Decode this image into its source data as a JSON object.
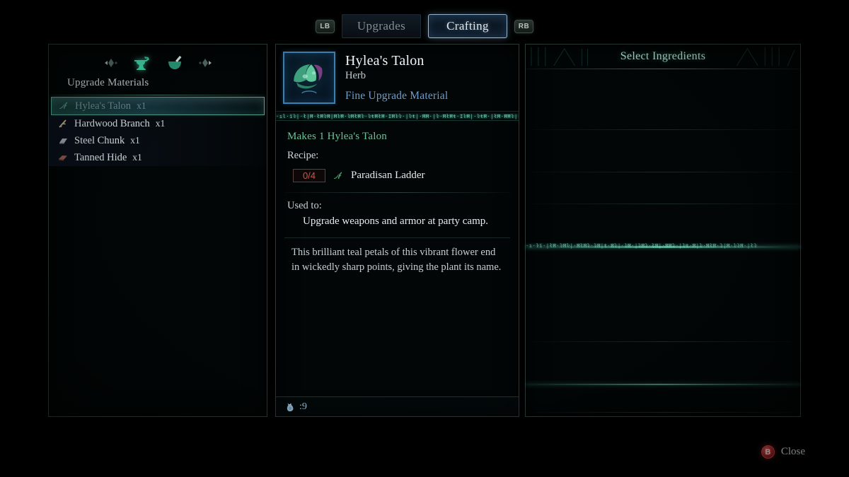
{
  "topbar": {
    "left_bumper": "LB",
    "right_bumper": "RB",
    "tabs": [
      {
        "label": "Upgrades",
        "active": false
      },
      {
        "label": "Crafting",
        "active": true
      }
    ]
  },
  "left_panel": {
    "prev_arrow_icon": "left-arrow-diamond-icon",
    "next_arrow_icon": "right-arrow-diamond-icon",
    "categories": [
      {
        "icon": "anvil-icon",
        "selected": true
      },
      {
        "icon": "mortar-pestle-icon",
        "selected": false
      }
    ],
    "category_title": "Upgrade Materials",
    "materials": [
      {
        "icon": "herb-icon",
        "name": "Hylea's Talon",
        "qty": "x1",
        "selected": true
      },
      {
        "icon": "branch-icon",
        "name": "Hardwood Branch",
        "qty": "x1",
        "selected": false
      },
      {
        "icon": "ingot-icon",
        "name": "Steel Chunk",
        "qty": "x1",
        "selected": false
      },
      {
        "icon": "hide-icon",
        "name": "Tanned Hide",
        "qty": "x1",
        "selected": false
      }
    ]
  },
  "center_panel": {
    "item_icon": "hyleas-talon-flower-icon",
    "item_name": "Hylea's Talon",
    "item_type": "Herb",
    "item_grade": "Fine Upgrade Material",
    "makes_line": "Makes 1 Hylea's Talon",
    "recipe_label": "Recipe:",
    "ingredients": [
      {
        "count": "0/4",
        "icon": "herb-icon",
        "name": "Paradisan Ladder"
      }
    ],
    "used_to_label": "Used to:",
    "used_to_value": "Upgrade weapons and armor at party camp.",
    "description": "This brilliant teal petals of this vibrant flower end in wickedly sharp points, giving the plant its name.",
    "currency_icon": "coin-pouch-icon",
    "currency_value": ":9"
  },
  "right_panel": {
    "title": "Select Ingredients"
  },
  "footer": {
    "close_button_glyph": "B",
    "close_label": "Close"
  },
  "colors": {
    "accent_teal": "#6cc49a",
    "accent_blue": "#6f9ece",
    "active_tab_border": "#9fc4de",
    "count_red": "#c05a4e",
    "selection_border": "#4f9f8c",
    "close_red": "#a81f24"
  },
  "runes": {
    "center": "·ıl·ĭŀ|·ł|Ħ·łĦŀĦ|ĦŀĦ·ŀĦłĦŀ·ŀŧĦłĦ·ĬĦŀŀ·|ŀŧ|·ĦĦ·|ŀ·ĦłĦŧ·ĬŀĦ|·ŀŧĦ·|łĦ·ĦĦŀ|·ŧĦ|·ĦŀĦ·ł|ŀ",
    "right": "·ı·ŀĭ·|łĦ·ŀĦŀ|·ĦłĦŀ·ŀĦ|ŧ·Ħŀ|·ŀĦ·|ŀĦŀ·łĦ|·ĦĦŀ·|ŀŧ·Ħ|ŀ·ĦłĦ·ŀ|Ħ·ŀŀĦ·|łŀ"
  }
}
